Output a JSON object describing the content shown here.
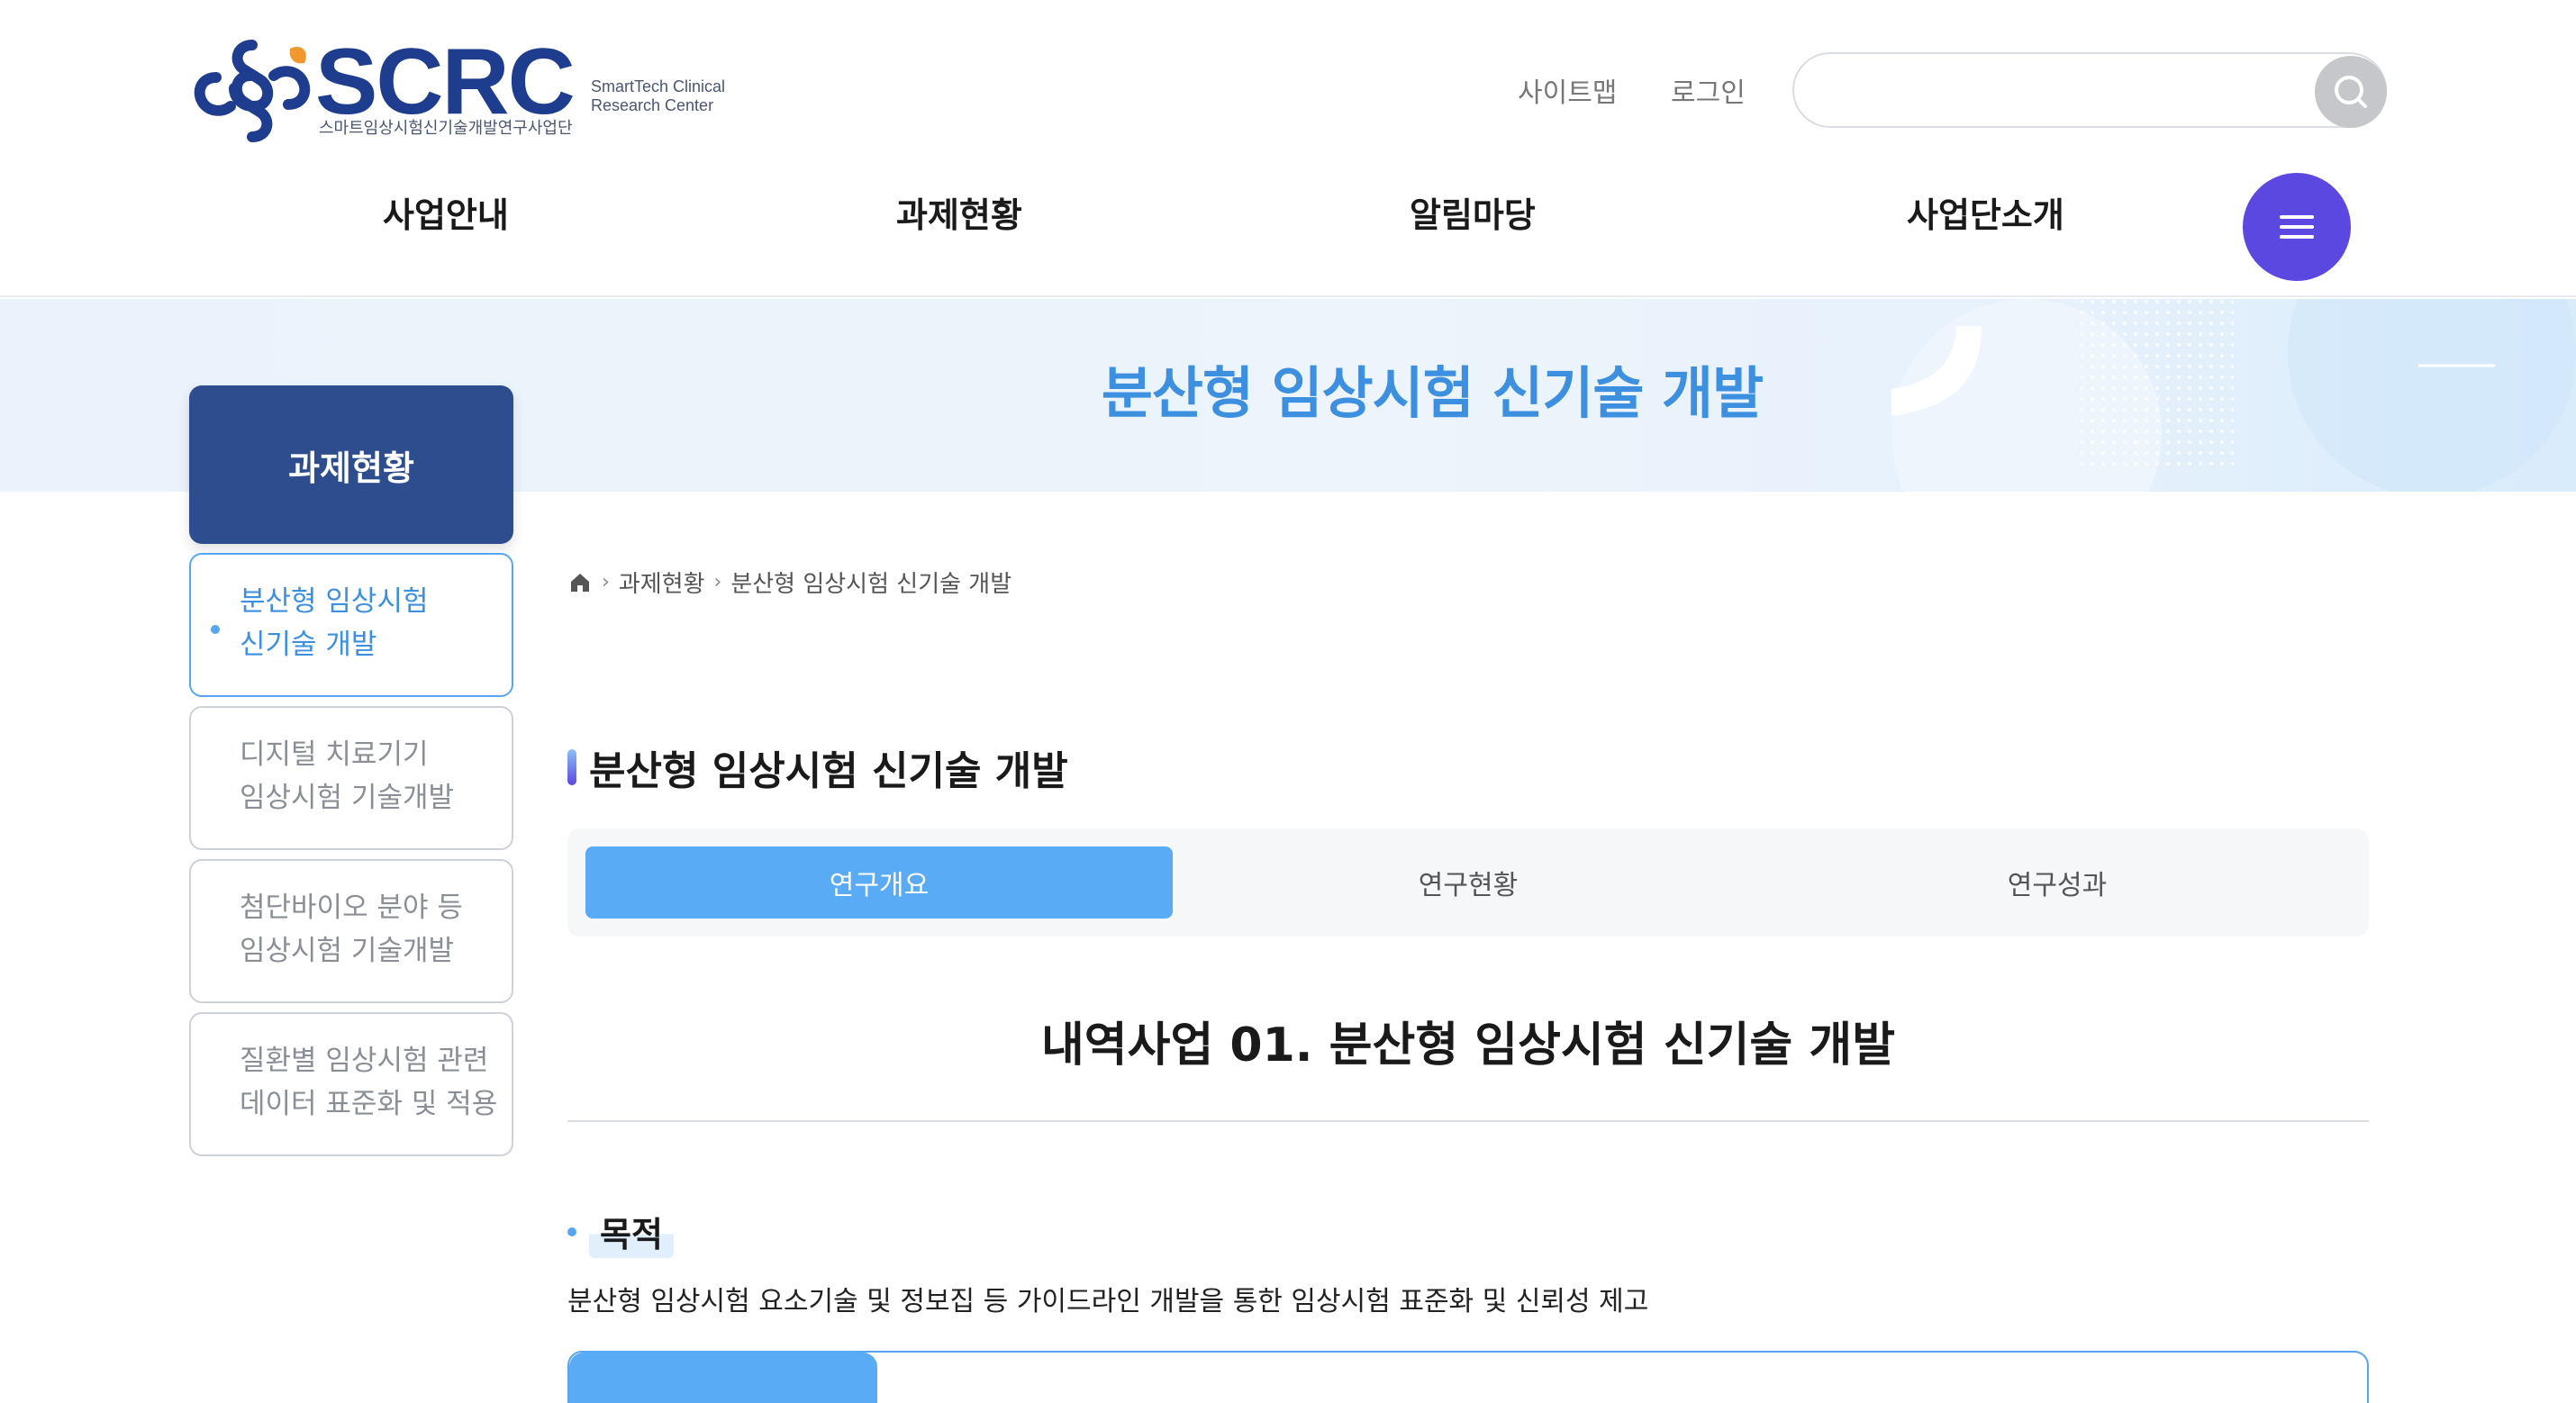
{
  "brand": {
    "name": "SCRC",
    "subtitle_en": "SmartTech Clinical Research Center",
    "subtitle_ko": "스마트임상시험신기술개발연구사업단",
    "colors": {
      "navy": "#1e3d8f",
      "orange": "#f0982e",
      "accent_blue": "#3d8fe0",
      "menu_purple": "#5b48e0"
    }
  },
  "utility": {
    "sitemap": "사이트맵",
    "login": "로그인",
    "search_placeholder": "",
    "search_icon": "search-icon"
  },
  "gnb": [
    "사업안내",
    "과제현황",
    "알림마당",
    "사업단소개"
  ],
  "banner": {
    "title": "분산형 임상시험 신기술 개발"
  },
  "sidebar": {
    "heading": "과제현황",
    "items": [
      {
        "line1": "분산형 임상시험",
        "line2": "신기술 개발",
        "active": true
      },
      {
        "line1": "디지털 치료기기",
        "line2": "임상시험 기술개발",
        "active": false
      },
      {
        "line1": "첨단바이오 분야 등",
        "line2": "임상시험 기술개발",
        "active": false
      },
      {
        "line1": "질환별 임상시험 관련",
        "line2": "데이터 표준화 및 적용",
        "active": false
      }
    ]
  },
  "breadcrumb": {
    "home_icon": "home-icon",
    "level1": "과제현황",
    "level2": "분산형 임상시험 신기술 개발"
  },
  "page_title": "분산형 임상시험 신기술 개발",
  "tabs": [
    {
      "label": "연구개요",
      "active": true
    },
    {
      "label": "연구현황",
      "active": false
    },
    {
      "label": "연구성과",
      "active": false
    }
  ],
  "section": {
    "heading": "내역사업 01. 분산형 임상시험 신기술 개발",
    "purpose_label": "목적",
    "purpose_text": "분산형 임상시험 요소기술 및 정보집 등 가이드라인 개발을 통한 임상시험 표준화 및 신뢰성 제고"
  }
}
